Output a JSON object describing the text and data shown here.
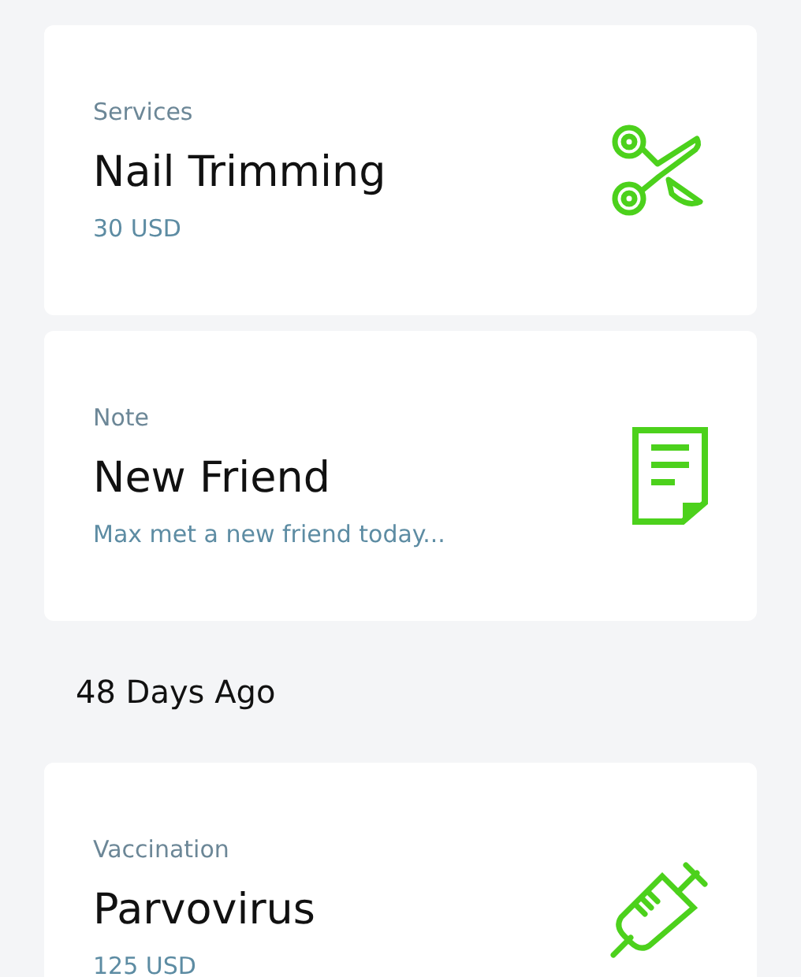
{
  "timeline": [
    {
      "kind": "service",
      "category": "Services",
      "title": "Nail Trimming",
      "detail": "30 USD"
    },
    {
      "kind": "note",
      "category": "Note",
      "title": "New Friend",
      "detail": "Max met a new friend today..."
    },
    {
      "kind": "heading",
      "text": "48 Days Ago"
    },
    {
      "kind": "vaccination",
      "category": "Vaccination",
      "title": "Parvovirus",
      "detail": "125 USD"
    }
  ]
}
